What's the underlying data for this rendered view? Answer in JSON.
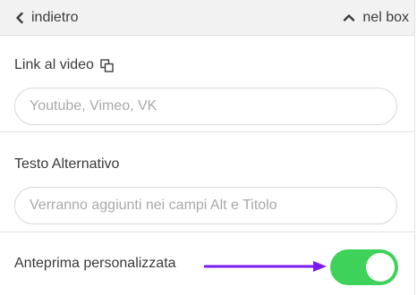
{
  "topbar": {
    "back_label": "indietro",
    "collapse_label": "nel box"
  },
  "video_link": {
    "label": "Link al video",
    "placeholder": "Youtube, Vimeo, VK",
    "value": ""
  },
  "alt_text": {
    "label": "Testo Alternativo",
    "placeholder": "Verranno aggiunti nei campi Alt e Titolo",
    "value": ""
  },
  "custom_preview": {
    "label": "Anteprima personalizzata",
    "enabled": true
  },
  "icons": {
    "back": "chevron-left-icon",
    "collapse": "chevron-up-icon",
    "copy": "copy-icon",
    "annotation": "arrow-right-icon"
  },
  "colors": {
    "toggle_on": "#3ed25a",
    "annotation_arrow": "#7a1cf0",
    "topbar_bg": "#f2f2f2"
  }
}
